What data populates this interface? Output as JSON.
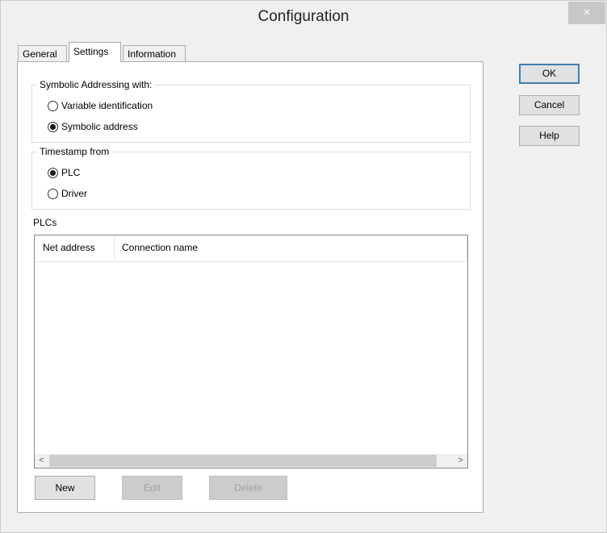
{
  "window": {
    "title": "Configuration",
    "close_glyph": "×"
  },
  "tabs": [
    {
      "label": "General",
      "active": false
    },
    {
      "label": "Settings",
      "active": true
    },
    {
      "label": "Information",
      "active": false
    }
  ],
  "symbolic_addressing": {
    "title": "Symbolic Addressing with:",
    "options": [
      {
        "label": "Variable identification",
        "checked": false
      },
      {
        "label": "Symbolic address",
        "checked": true
      }
    ]
  },
  "timestamp": {
    "title": "Timestamp from",
    "options": [
      {
        "label": "PLC",
        "checked": true
      },
      {
        "label": "Driver",
        "checked": false
      }
    ]
  },
  "plcs": {
    "label": "PLCs",
    "columns": [
      "Net address",
      "Connection name"
    ],
    "rows": [],
    "scroll_left": "<",
    "scroll_right": ">"
  },
  "list_buttons": {
    "new": "New",
    "edit": "Edit",
    "delete": "Delete"
  },
  "dialog_buttons": {
    "ok": "OK",
    "cancel": "Cancel",
    "help": "Help"
  }
}
